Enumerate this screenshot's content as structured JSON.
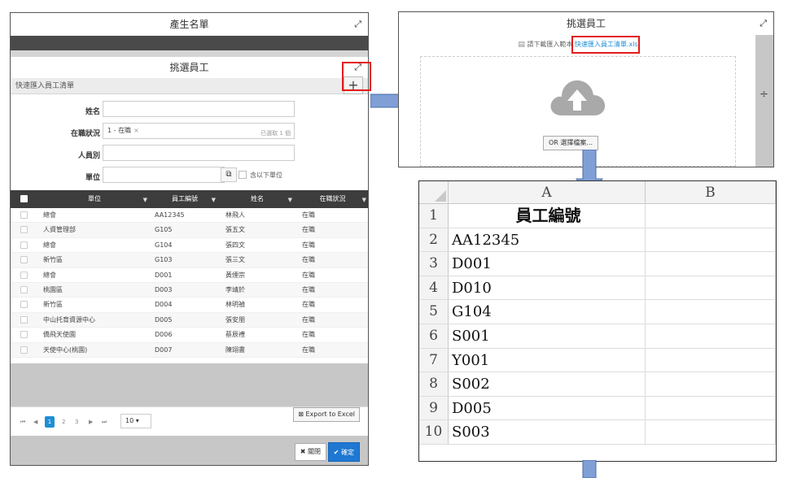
{
  "left_panel": {
    "title": "產生名單",
    "inner_title": "挑選員工",
    "quick_import_label": "快速匯入員工清單",
    "plus_symbol": "+",
    "form": {
      "name_label": "姓名",
      "status_label": "在職狀況",
      "status_chip": "1 - 在職",
      "status_selected": "已選取 1 個",
      "type_label": "人員別",
      "unit_label": "單位",
      "include_sub_label": "含以下單位"
    },
    "grid": {
      "headers": [
        "單位",
        "員工編號",
        "姓名",
        "在職狀況"
      ],
      "rows": [
        [
          "總會",
          "AA12345",
          "林飛人",
          "在職"
        ],
        [
          "人資管理部",
          "G105",
          "張五文",
          "在職"
        ],
        [
          "總會",
          "G104",
          "張四文",
          "在職"
        ],
        [
          "新竹區",
          "G103",
          "張三文",
          "在職"
        ],
        [
          "總會",
          "D001",
          "黃煙宗",
          "在職"
        ],
        [
          "桃園區",
          "D003",
          "李靖於",
          "在職"
        ],
        [
          "新竹區",
          "D004",
          "林明禎",
          "在職"
        ],
        [
          "中山托育資源中心",
          "D005",
          "張安朋",
          "在職"
        ],
        [
          "僑飛天使園",
          "D006",
          "蔡辰禮",
          "在職"
        ],
        [
          "天使中心(桃園)",
          "D007",
          "陳翊書",
          "在職"
        ]
      ]
    },
    "pager": {
      "first": "⏮",
      "prev": "◀",
      "pages": [
        "1",
        "2",
        "3"
      ],
      "next": "▶",
      "last": "⏭",
      "page_size": "10"
    },
    "export_label": "Export to Excel",
    "close_label": "關閉",
    "ok_label": "確定"
  },
  "right_top": {
    "title": "挑選員工",
    "download_text": "請下載匯入範本",
    "download_link": "快速匯入員工清單.xls",
    "choose_file": "OR 選擇檔案...",
    "side_symbol": "÷"
  },
  "excel": {
    "col_headers": [
      "A",
      "B"
    ],
    "row_numbers": [
      "1",
      "2",
      "3",
      "4",
      "5",
      "6",
      "7",
      "8",
      "9",
      "10"
    ],
    "header_cell": "員工編號",
    "values": [
      "AA12345",
      "D001",
      "D010",
      "G104",
      "S001",
      "Y001",
      "S002",
      "D005",
      "S003"
    ]
  },
  "colors": {
    "red_highlight": "#e31b1b",
    "arrow_blue": "#7f9fd6",
    "primary_blue": "#1e78d2",
    "link_blue": "#1e8fd5"
  }
}
